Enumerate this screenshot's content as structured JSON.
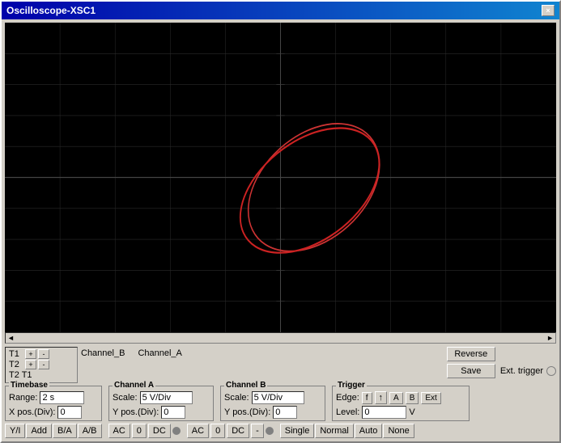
{
  "window": {
    "title": "Oscilloscope-XSC1",
    "close_label": "×"
  },
  "time_markers": {
    "t1_label": "T1",
    "t2_label": "T2",
    "t2t1_label": "T2 T1"
  },
  "channel_labels": {
    "ch_b": "Channel_B",
    "ch_a": "Channel_A"
  },
  "buttons": {
    "reverse": "Reverse",
    "save": "Save",
    "ext_trigger": "Ext. trigger"
  },
  "timebase": {
    "title": "Timebase",
    "range_label": "Range:",
    "range_value": "2 s",
    "xpos_label": "X pos.(Div):",
    "xpos_value": "0",
    "ya_label": "Y/I",
    "add_label": "Add",
    "ba_label": "B/A",
    "ab_label": "A/B"
  },
  "channel_a": {
    "title": "Channel A",
    "scale_label": "Scale:",
    "scale_value": "5 V/Div",
    "ypos_label": "Y pos.(Div):",
    "ypos_value": "0",
    "ac_label": "AC",
    "zero_label": "0",
    "dc_label": "DC"
  },
  "channel_b": {
    "title": "Channel B",
    "scale_label": "Scale:",
    "scale_value": "5 V/Div",
    "ypos_label": "Y pos.(Div):",
    "ypos_value": "0",
    "ac_label": "AC",
    "zero_label": "0",
    "dc_label": "DC",
    "dash_label": "-"
  },
  "trigger": {
    "title": "Trigger",
    "edge_label": "Edge:",
    "f_label": "f",
    "fall_label": "↑",
    "a_label": "A",
    "b_label": "B",
    "ext_label": "Ext",
    "level_label": "Level:",
    "level_value": "0",
    "v_label": "V",
    "single_label": "Single",
    "normal_label": "Normal",
    "auto_label": "Auto",
    "none_label": "None"
  },
  "colors": {
    "title_bar_start": "#0050b0",
    "title_bar_end": "#1890e0",
    "screen_bg": "#000000",
    "grid_color": "#333333",
    "waveform_color": "#cc2222",
    "normal_active_bg": "#b8d4f0"
  }
}
